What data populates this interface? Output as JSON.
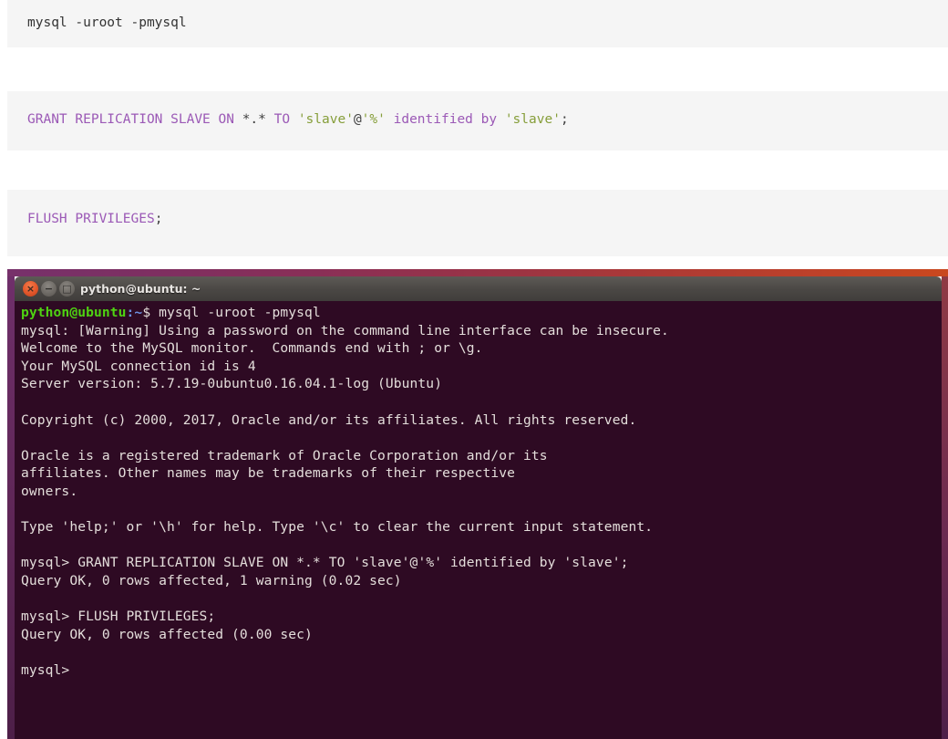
{
  "document": {
    "code_blocks": [
      {
        "name": "mysql-login-command",
        "language": "shell",
        "tokens": [
          {
            "t": "mysql -uroot -pmysql",
            "c": "plain"
          }
        ],
        "text": "mysql -uroot -pmysql"
      },
      {
        "name": "grant-replication-slave-statement",
        "language": "sql",
        "tokens": [
          {
            "t": "GRANT REPLICATION SLAVE ON ",
            "c": "kw"
          },
          {
            "t": "*.*",
            "c": "op"
          },
          {
            "t": " TO ",
            "c": "kw"
          },
          {
            "t": "'slave'",
            "c": "str"
          },
          {
            "t": "@",
            "c": "pun"
          },
          {
            "t": "'%'",
            "c": "str"
          },
          {
            "t": " identified by ",
            "c": "kw"
          },
          {
            "t": "'slave'",
            "c": "str"
          },
          {
            "t": ";",
            "c": "pun"
          }
        ],
        "text": "GRANT REPLICATION SLAVE ON *.* TO 'slave'@'%' identified by 'slave';"
      },
      {
        "name": "flush-privileges-statement",
        "language": "sql",
        "tokens": [
          {
            "t": "FLUSH PRIVILEGES",
            "c": "kw"
          },
          {
            "t": ";",
            "c": "pun"
          }
        ],
        "text": "FLUSH PRIVILEGES;"
      }
    ],
    "syntax_colors": {
      "keyword": "#9b59b6",
      "string": "#869e3a",
      "punctuation": "#3f3f3f",
      "code_background": "#f5f5f5",
      "page_background": "#ffffff"
    }
  },
  "terminal": {
    "window_title": "python@ubuntu: ~",
    "buttons": {
      "close": "×",
      "minimize": "−",
      "maximize": "□"
    },
    "colors": {
      "background": "#2e0a23",
      "foreground": "#e4dedb",
      "titlebar": "#4a4744",
      "prompt_user": "#4fd312",
      "prompt_path": "#6c8fe0",
      "frame_gradient_start": "#77316b",
      "frame_gradient_end": "#c9481f"
    },
    "prompt": {
      "user_host": "python@ubuntu",
      "path": ":~",
      "symbol": "$"
    },
    "command_1": "mysql -uroot -pmysql",
    "output_lines": [
      "mysql: [Warning] Using a password on the command line interface can be insecure.",
      "Welcome to the MySQL monitor.  Commands end with ; or \\g.",
      "Your MySQL connection id is 4",
      "Server version: 5.7.19-0ubuntu0.16.04.1-log (Ubuntu)",
      "",
      "Copyright (c) 2000, 2017, Oracle and/or its affiliates. All rights reserved.",
      "",
      "Oracle is a registered trademark of Oracle Corporation and/or its",
      "affiliates. Other names may be trademarks of their respective",
      "owners.",
      "",
      "Type 'help;' or '\\h' for help. Type '\\c' to clear the current input statement."
    ],
    "mysql_prompt": "mysql> ",
    "session": [
      {
        "prompt": "mysql> ",
        "command": "GRANT REPLICATION SLAVE ON *.* TO 'slave'@'%' identified by 'slave';",
        "result": "Query OK, 0 rows affected, 1 warning (0.02 sec)"
      },
      {
        "prompt": "mysql> ",
        "command": "FLUSH PRIVILEGES;",
        "result": "Query OK, 0 rows affected (0.00 sec)"
      }
    ],
    "final_prompt": "mysql>"
  }
}
